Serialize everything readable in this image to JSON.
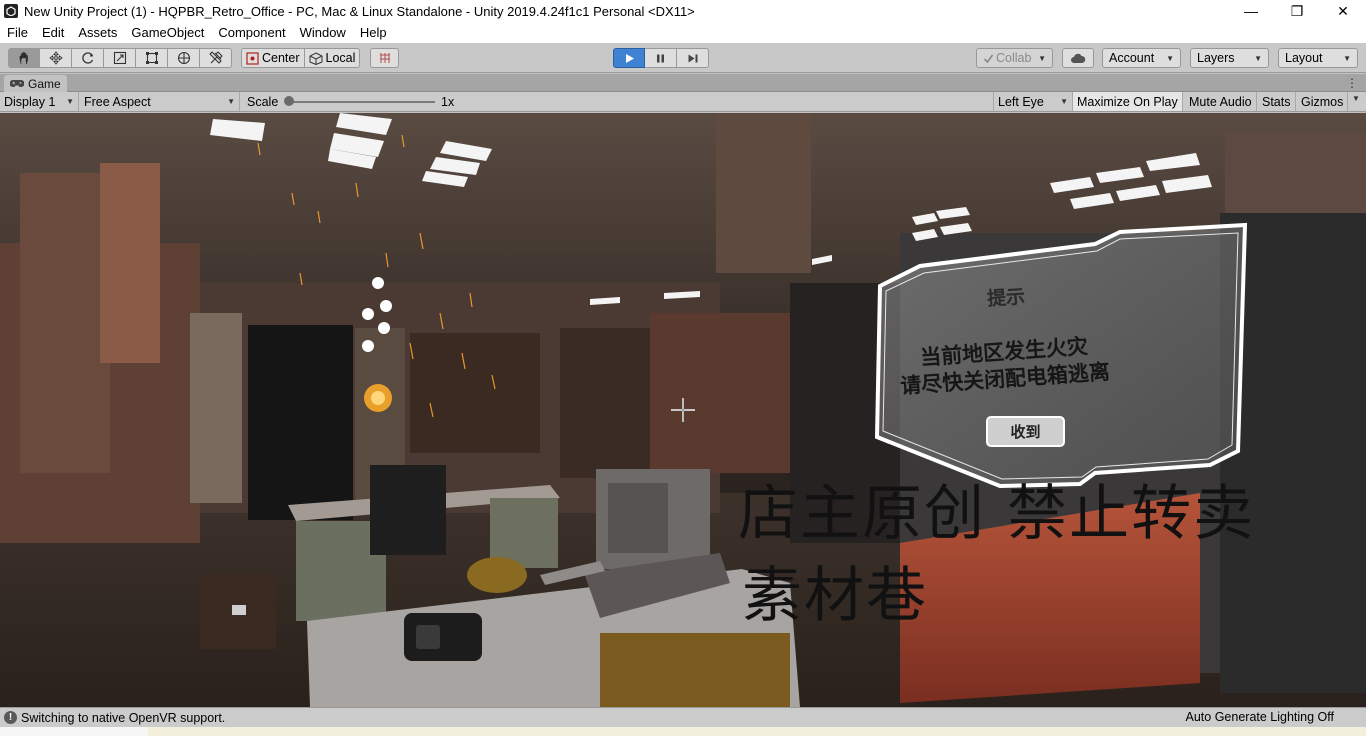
{
  "window": {
    "title": "New Unity Project (1) - HQPBR_Retro_Office - PC, Mac & Linux Standalone - Unity 2019.4.24f1c1 Personal <DX11>",
    "minimize": "—",
    "maximize": "❐",
    "close": "✕"
  },
  "menu": [
    "File",
    "Edit",
    "Assets",
    "GameObject",
    "Component",
    "Window",
    "Help"
  ],
  "toolbar": {
    "tools": [
      "hand-icon",
      "move-icon",
      "rotate-icon",
      "scale-icon",
      "rect-icon",
      "transform-icon",
      "custom-tool-icon"
    ],
    "pivot_center": "Center",
    "pivot_local": "Local",
    "collab": "Collab",
    "account": "Account",
    "layers": "Layers",
    "layout": "Layout",
    "accent": "#3f82d4"
  },
  "game_tab": {
    "label": "Game",
    "menu": "⋮"
  },
  "game_toolbar": {
    "display": "Display 1",
    "aspect": "Free Aspect",
    "scale_label": "Scale",
    "scale_value": "1x",
    "eye": "Left Eye",
    "maximize_on_play": "Maximize On Play",
    "mute_audio": "Mute Audio",
    "stats": "Stats",
    "gizmos": "Gizmos"
  },
  "scene": {
    "dialog_title": "提示",
    "dialog_line1": "当前地区发生火灾",
    "dialog_line2": "请尽快关闭配电箱逃离",
    "dialog_button": "收到",
    "watermark_line1": "店主原创 禁止转卖",
    "watermark_line2": "素材巷",
    "crosshair": "+"
  },
  "status": {
    "icon": "!",
    "message": "Switching to native OpenVR support.",
    "right": "Auto Generate Lighting Off"
  }
}
